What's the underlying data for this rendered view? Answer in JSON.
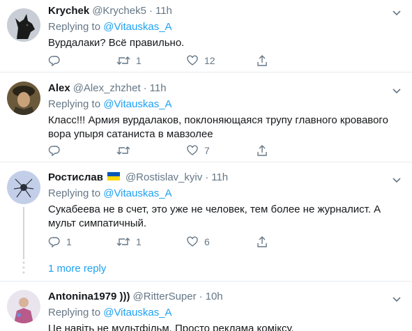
{
  "tweets": [
    {
      "name": "Krychek",
      "handle": "@Krychek5",
      "time": "11h",
      "replying_label": "Replying to",
      "replying_to": "@Vitauskas_A",
      "text": "Вурдалаки? Всё правильно.",
      "retweets": "1",
      "likes": "12"
    },
    {
      "name": "Alex",
      "handle": "@Alex_zhzhet",
      "time": "11h",
      "replying_label": "Replying to",
      "replying_to": "@Vitauskas_A",
      "text": "Класс!!! Армия вурдалаков, поклоняющаяся трупу главного кровавого вора упыря сатаниста в мавзолее",
      "retweets": "",
      "likes": "7"
    },
    {
      "name": "Ростислав",
      "handle": "@Rostislav_kyiv",
      "time": "11h",
      "replying_label": "Replying to",
      "replying_to": "@Vitauskas_A",
      "text": "Сукабеева не в счет, это уже не человек, тем более не журналист. А мульт симпатичный.",
      "replies": "1",
      "retweets": "1",
      "likes": "6"
    },
    {
      "name": "Antonina1979 )))",
      "handle": "@RitterSuper",
      "time": "10h",
      "replying_label": "Replying to",
      "replying_to": "@Vitauskas_A",
      "text": "Це навіть не мультфільм. Просто реклама коміксу."
    }
  ],
  "more_reply": "1 more reply",
  "colors": {
    "accent": "#1da1f2",
    "secondary_text": "#657786",
    "divider": "#e6ecf0"
  }
}
